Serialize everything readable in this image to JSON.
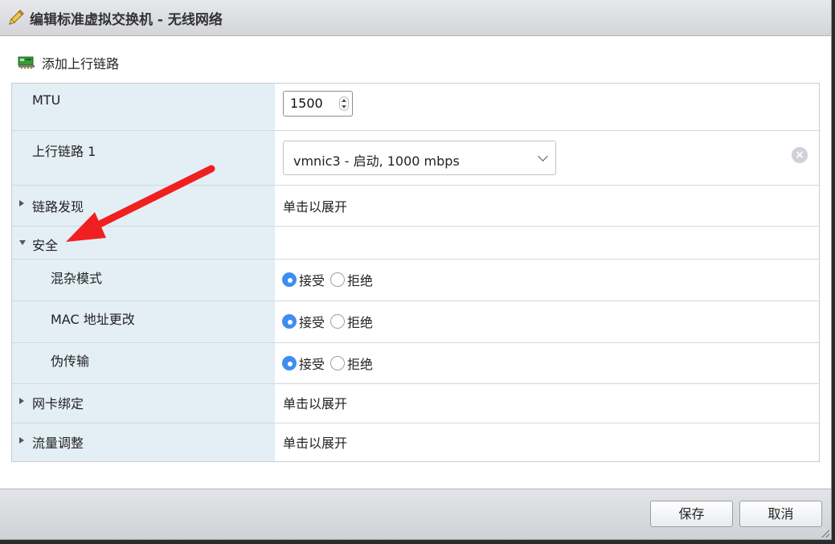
{
  "window": {
    "title": "编辑标准虚拟交换机 - 无线网络"
  },
  "toolbar": {
    "add_uplink_label": "添加上行链路"
  },
  "rows": {
    "mtu": {
      "label": "MTU",
      "value": "1500"
    },
    "uplink1": {
      "label": "上行链路 1",
      "selected": "vmnic3 - 启动, 1000 mbps"
    },
    "link_discovery": {
      "label": "链路发现",
      "value": "单击以展开"
    },
    "security": {
      "label": "安全"
    },
    "promiscuous": {
      "label": "混杂模式",
      "accept": "接受",
      "reject": "拒绝",
      "selected": "接受"
    },
    "mac_change": {
      "label": "MAC 地址更改",
      "accept": "接受",
      "reject": "拒绝",
      "selected": "接受"
    },
    "forged": {
      "label": "伪传输",
      "accept": "接受",
      "reject": "拒绝",
      "selected": "接受"
    },
    "nic_teaming": {
      "label": "网卡绑定",
      "value": "单击以展开"
    },
    "traffic_shaping": {
      "label": "流量调整",
      "value": "单击以展开"
    }
  },
  "footer": {
    "save_label": "保存",
    "cancel_label": "取消"
  },
  "colors": {
    "radio_selected": "#3d8ef0",
    "arrow": "#f02020",
    "left_column": "#e4eef5"
  }
}
